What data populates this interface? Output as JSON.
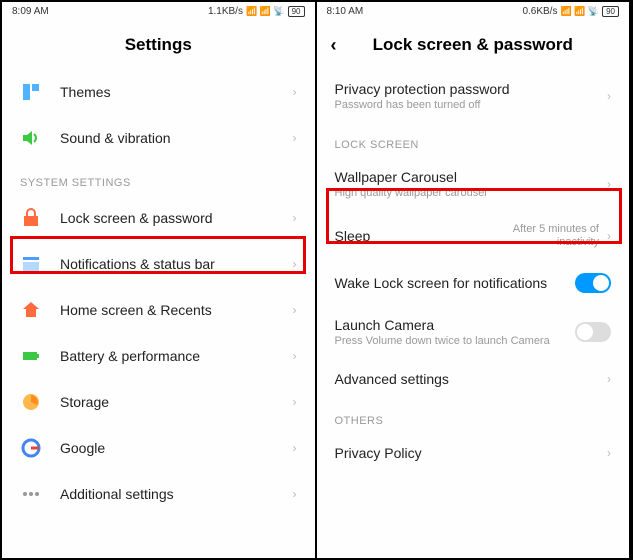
{
  "left": {
    "status": {
      "time": "8:09 AM",
      "speed": "1.1KB/s",
      "battery": "90"
    },
    "title": "Settings",
    "section_label": "SYSTEM SETTINGS",
    "items": [
      {
        "label": "Themes"
      },
      {
        "label": "Sound & vibration"
      },
      {
        "label": "Lock screen & password"
      },
      {
        "label": "Notifications & status bar"
      },
      {
        "label": "Home screen & Recents"
      },
      {
        "label": "Battery & performance"
      },
      {
        "label": "Storage"
      },
      {
        "label": "Google"
      },
      {
        "label": "Additional settings"
      }
    ]
  },
  "right": {
    "status": {
      "time": "8:10 AM",
      "speed": "0.6KB/s",
      "battery": "90"
    },
    "title": "Lock screen & password",
    "section_lock": "LOCK SCREEN",
    "section_others": "OTHERS",
    "items": {
      "privacy": {
        "label": "Privacy protection password",
        "sub": "Password has been turned off"
      },
      "carousel": {
        "label": "Wallpaper Carousel",
        "sub": "High quality wallpaper carousel"
      },
      "sleep": {
        "label": "Sleep",
        "value": "After 5 minutes of inactivity"
      },
      "wake": {
        "label": "Wake Lock screen for notifications"
      },
      "camera": {
        "label": "Launch Camera",
        "sub": "Press Volume down twice to launch Camera"
      },
      "advanced": {
        "label": "Advanced settings"
      },
      "privacy_policy": {
        "label": "Privacy Policy"
      }
    }
  }
}
